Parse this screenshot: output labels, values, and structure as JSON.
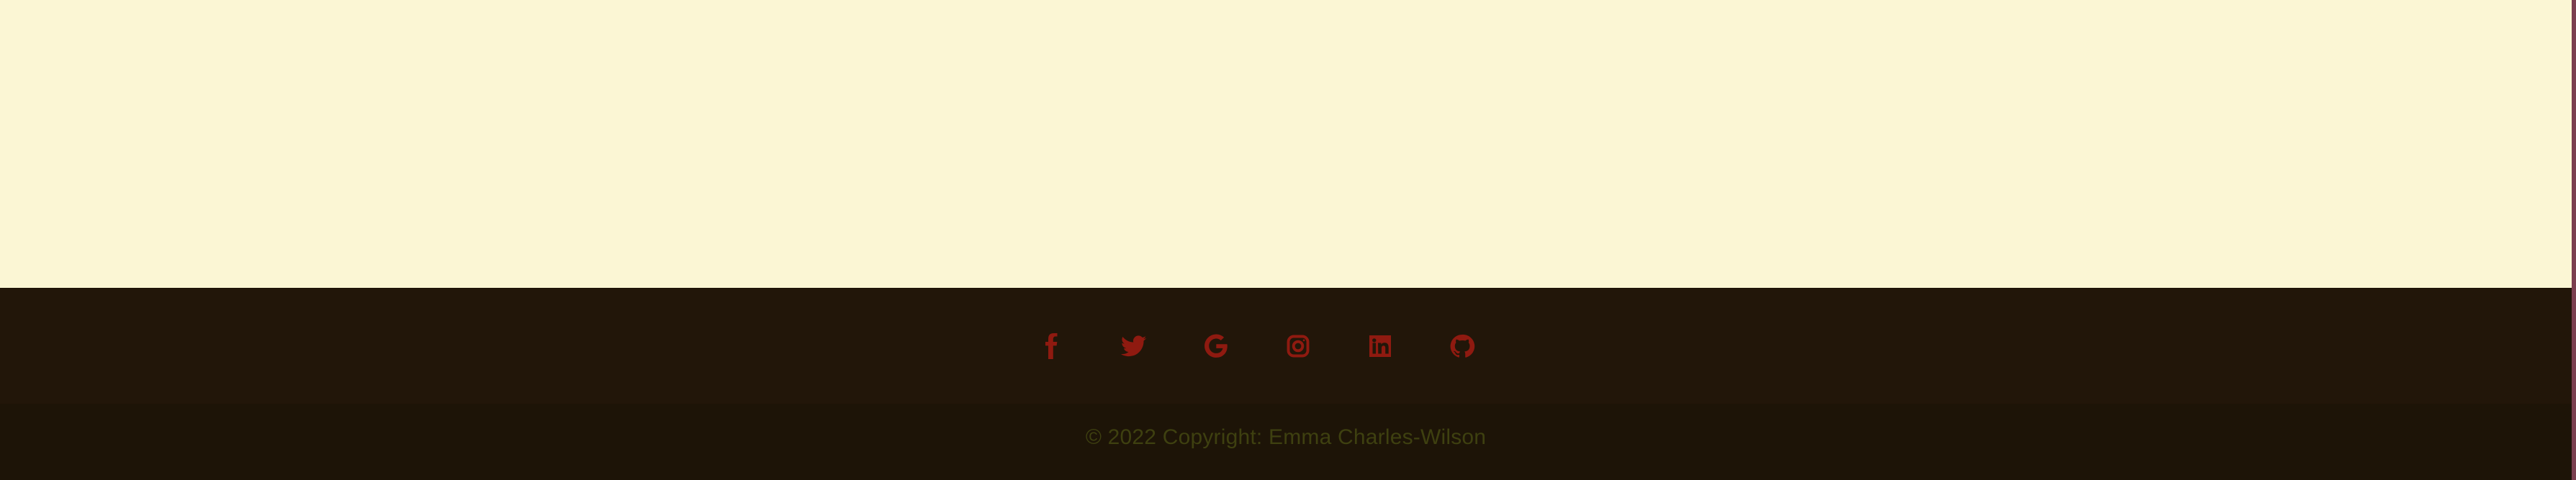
{
  "footer": {
    "social_icons": [
      {
        "name": "facebook-icon"
      },
      {
        "name": "twitter-icon"
      },
      {
        "name": "google-icon"
      },
      {
        "name": "instagram-icon"
      },
      {
        "name": "linkedin-icon"
      },
      {
        "name": "github-icon"
      }
    ],
    "copyright_text": "© 2022 Copyright: Emma Charles-Wilson"
  },
  "colors": {
    "content_background": "#fbf6d4",
    "footer_background": "#211608",
    "icon": "#8f1a10",
    "copyright_text": "#3e4010"
  }
}
